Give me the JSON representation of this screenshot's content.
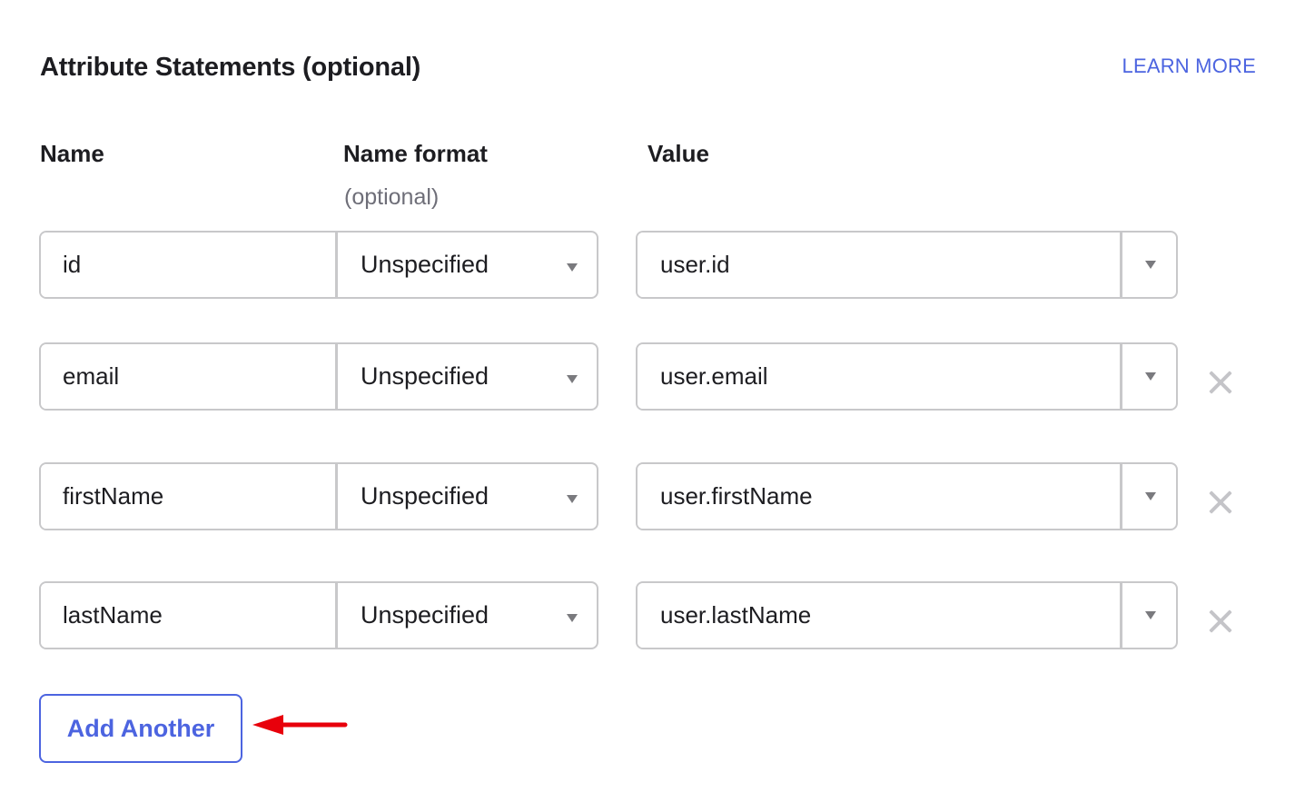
{
  "section": {
    "title": "Attribute Statements (optional)",
    "learn_more_label": "LEARN MORE"
  },
  "columns": {
    "name": "Name",
    "name_format": "Name format",
    "name_format_sub": "(optional)",
    "value": "Value"
  },
  "rows": [
    {
      "name": "id",
      "name_format": "Unspecified",
      "value": "user.id",
      "removable": false
    },
    {
      "name": "email",
      "name_format": "Unspecified",
      "value": "user.email",
      "removable": true
    },
    {
      "name": "firstName",
      "name_format": "Unspecified",
      "value": "user.firstName",
      "removable": true
    },
    {
      "name": "lastName",
      "name_format": "Unspecified",
      "value": "user.lastName",
      "removable": true
    }
  ],
  "icons": {
    "caret": "caret-down-icon",
    "remove": "close-x-icon",
    "annotation": "red-arrow-left-icon"
  },
  "add_button_label": "Add Another",
  "colors": {
    "accent": "#4c64e0",
    "border": "#c8c8ca",
    "annotation_arrow": "#e8000b",
    "remove_icon": "#c4c4c8"
  }
}
